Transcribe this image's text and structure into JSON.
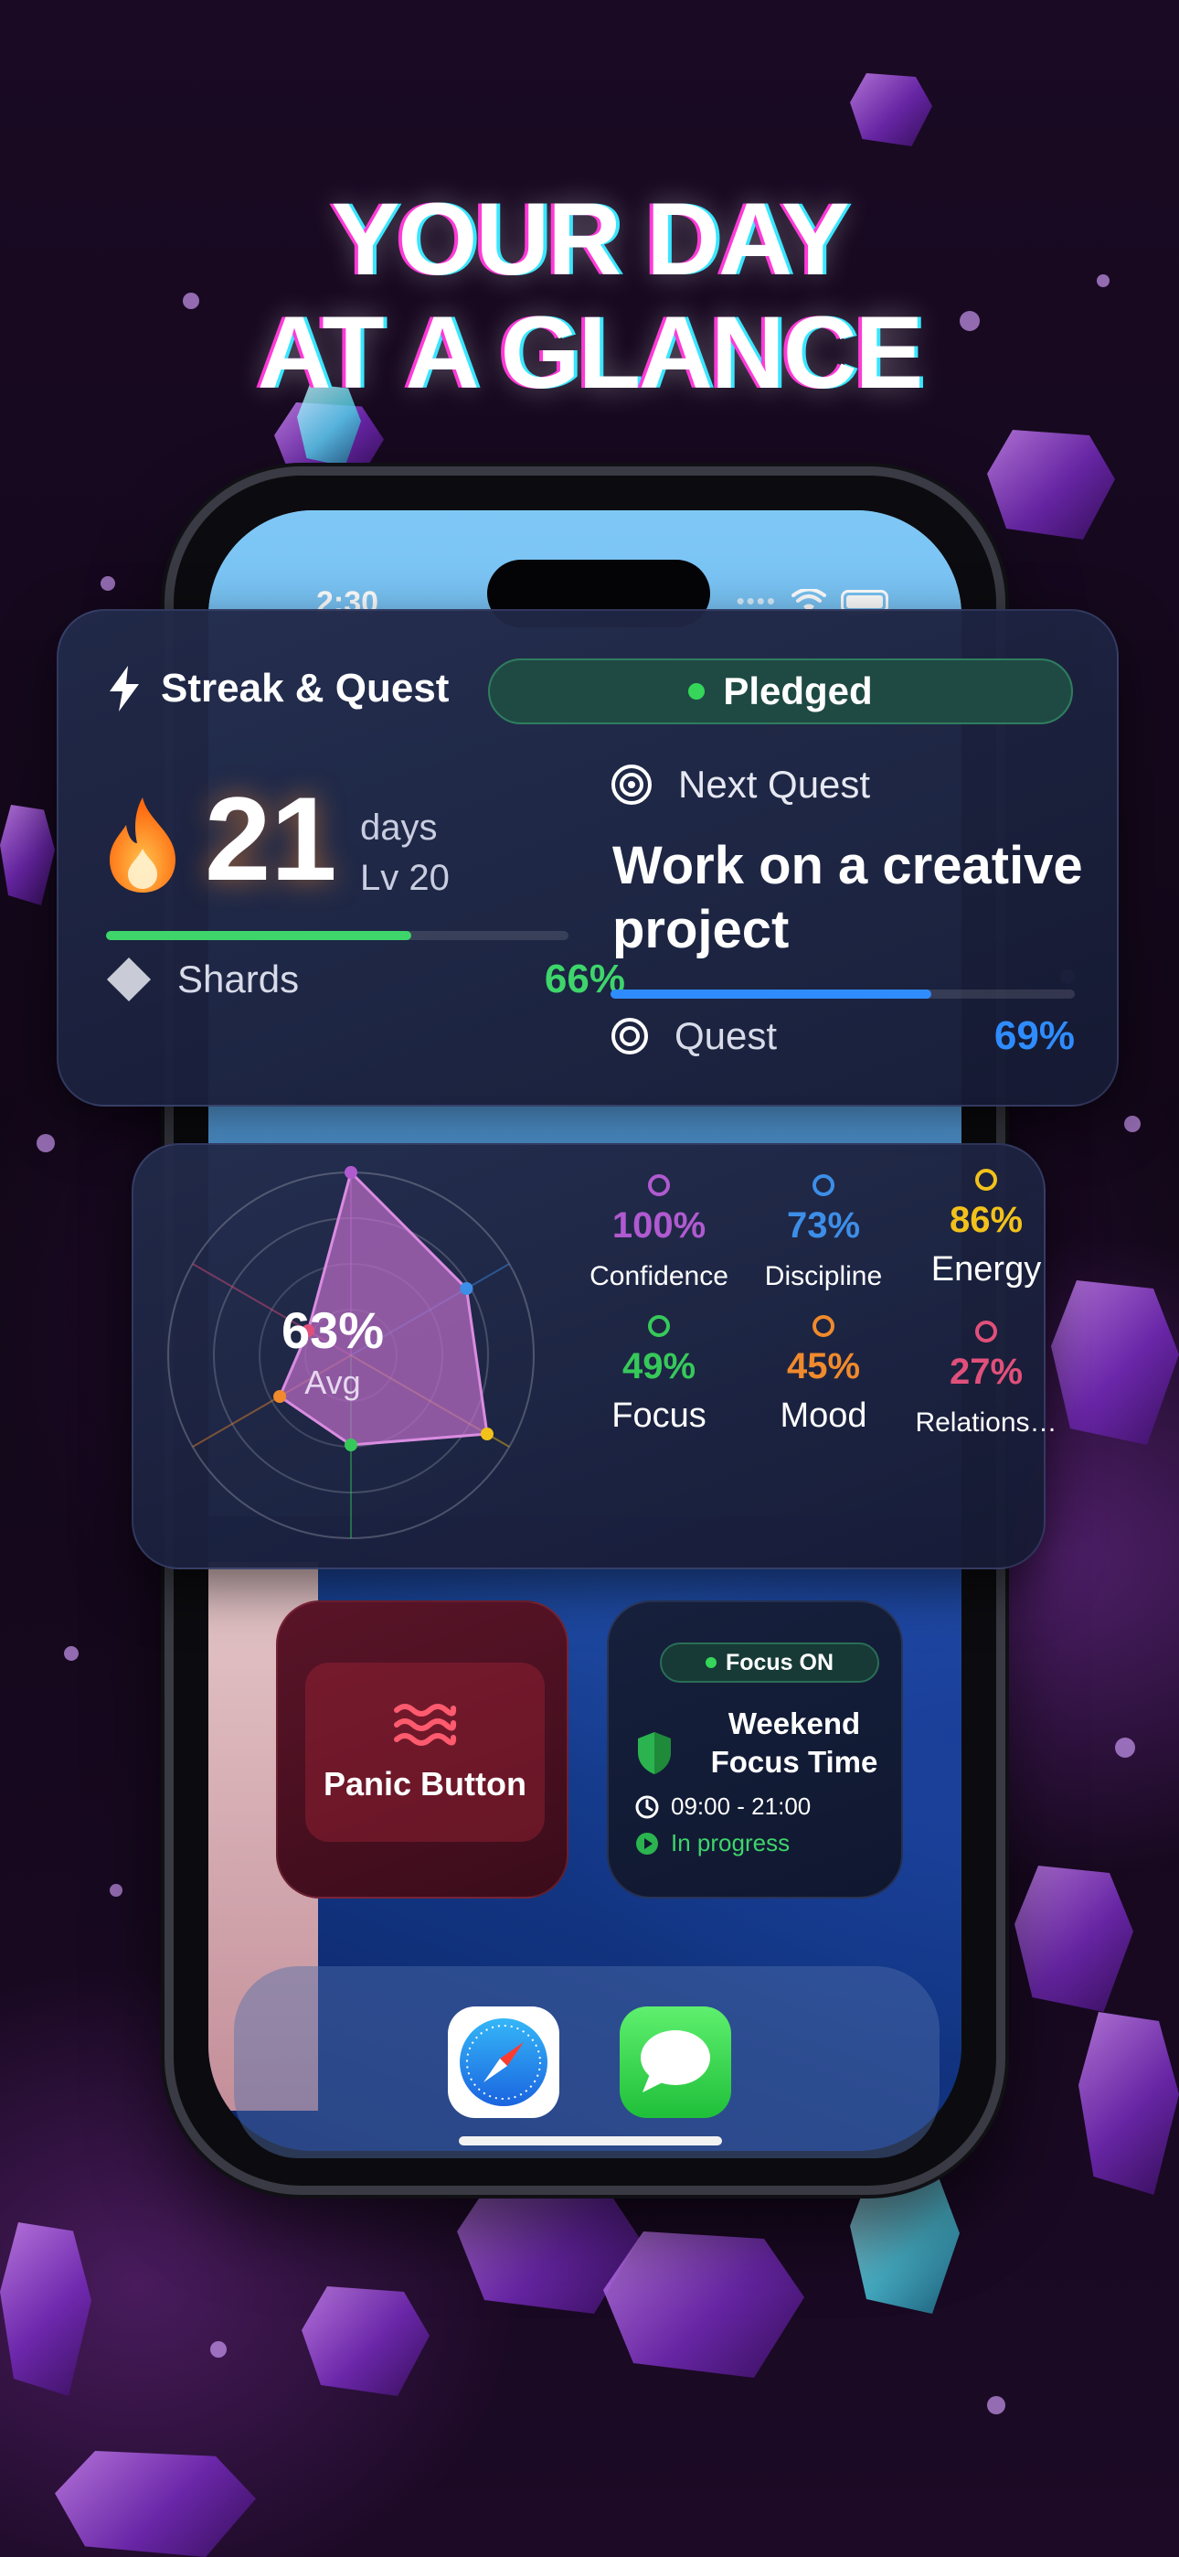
{
  "headline": {
    "line1": "YOUR DAY",
    "line2": "AT A GLANCE"
  },
  "status_bar": {
    "time": "2:30"
  },
  "streak_card": {
    "title": "Streak & Quest",
    "icon": "lightning-icon",
    "pledged_label": "Pledged",
    "streak_number": "21",
    "days_label": "days",
    "level_label": "Lv 20",
    "streak_progress": 0.66,
    "shards_label": "Shards",
    "shards_percent": "66%",
    "next_quest_label": "Next Quest",
    "quest_title": "Work on a creative project",
    "quest_label": "Quest",
    "quest_percent": "69%",
    "quest_progress": 0.69,
    "colors": {
      "accent_green": "#3ed56b",
      "accent_blue": "#2f8cff",
      "flame": "#ff8a1f"
    }
  },
  "radar_card": {
    "avg_value": "63%",
    "avg_label": "Avg",
    "stats": [
      {
        "value": "100%",
        "name": "Confidence",
        "color": "#b05ad0"
      },
      {
        "value": "73%",
        "name": "Discipline",
        "color": "#3d8ee8"
      },
      {
        "value": "86%",
        "name": "Energy",
        "color": "#f2c21b"
      },
      {
        "value": "49%",
        "name": "Focus",
        "color": "#36c95a"
      },
      {
        "value": "45%",
        "name": "Mood",
        "color": "#f08a2c"
      },
      {
        "value": "27%",
        "name": "Relations…",
        "color": "#e0507a"
      }
    ]
  },
  "widgets": {
    "panic_label": "Panic Button",
    "focus_status": "Focus ON",
    "focus_title": "Weekend Focus Time",
    "focus_hours": "09:00 - 21:00",
    "focus_progress": "In progress"
  },
  "dock": {
    "apps": [
      "Safari",
      "Messages"
    ]
  }
}
